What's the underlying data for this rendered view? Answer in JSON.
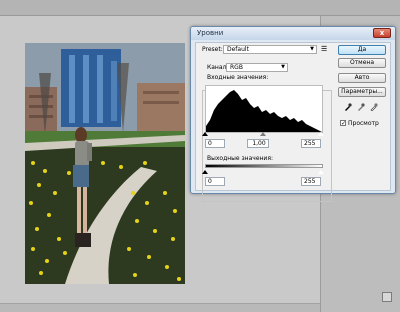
{
  "dialog": {
    "title": "Уровни",
    "close_glyph": "x",
    "preset_label": "Preset:",
    "preset_value": "Default",
    "preset_menu_icon": "list-icon",
    "channel_label": "Канал:",
    "channel_value": "RGB",
    "input_levels_label": "Входные значения:",
    "input_black": "0",
    "input_gamma": "1,00",
    "input_white": "255",
    "output_levels_label": "Выходные значения:",
    "output_black": "0",
    "output_white": "255",
    "buttons": {
      "ok": "Да",
      "cancel": "Отмена",
      "auto": "Авто",
      "options": "Параметры..."
    },
    "preview_label": "Просмотр",
    "preview_checked": true,
    "eyedroppers": [
      "black-eyedropper-icon",
      "gray-eyedropper-icon",
      "white-eyedropper-icon"
    ]
  },
  "colors": {
    "title_bar": "#c6d6ea",
    "close_button": "#c6412c",
    "workspace": "#c9c9c9",
    "default_button": "#bfe1f6"
  }
}
